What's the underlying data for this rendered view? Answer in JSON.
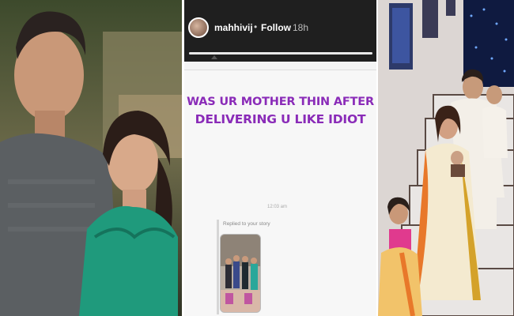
{
  "story": {
    "username": "mahhivij",
    "separator": "•",
    "follow_label": "Follow",
    "age": "18h",
    "progress": 1.0,
    "caption_line1": "WAS UR MOTHER THIN AFTER",
    "caption_line2": "DELIVERING U LIKE IDIOT",
    "caption_color": "#8a2bb8",
    "timestamp": "12:03 am",
    "reply_label": "Replied to your story"
  },
  "icons": {
    "avatar": "profile-avatar"
  }
}
